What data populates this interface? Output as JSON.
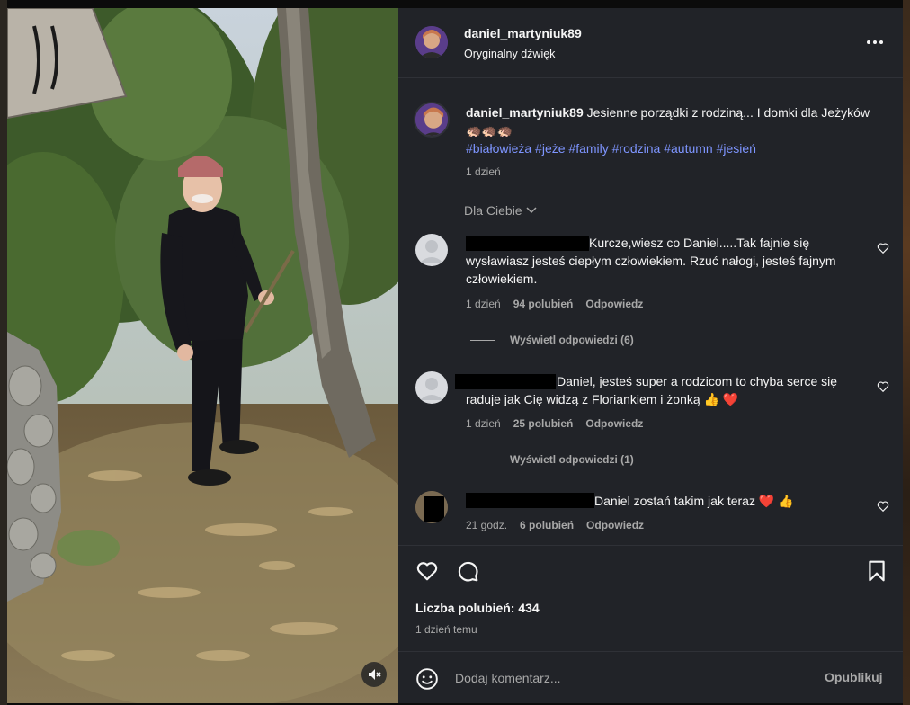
{
  "post": {
    "username": "daniel_martyniuk89",
    "audio_label": "Oryginalny dźwięk",
    "more_icon": "more-horizontal-icon"
  },
  "caption": {
    "username": "daniel_martyniuk89",
    "text": "Jesienne porządki z rodziną... I domki dla Jeżyków",
    "emoji": "🦔🦔🦔",
    "hashtags": "#białowieża #jeże #family #rodzina #autumn #jesień",
    "time": "1 dzień"
  },
  "sort_label": "Dla Ciebie",
  "comments": [
    {
      "text": "Kurcze,wiesz co Daniel.....Tak fajnie się wysławiasz jesteś ciepłym człowiekiem. Rzuć nałogi, jesteś fajnym człowiekiem.",
      "time": "1 dzień",
      "likes": "94 polubień",
      "reply": "Odpowiedz",
      "view_replies": "Wyświetl odpowiedzi (6)"
    },
    {
      "text": "Daniel, jesteś super a rodzicom to chyba serce się raduje jak Cię widzą z Floriankiem i żonką 👍 ❤️",
      "time": "1 dzień",
      "likes": "25 polubień",
      "reply": "Odpowiedz",
      "view_replies": "Wyświetl odpowiedzi (1)"
    },
    {
      "text": "Daniel zostań takim jak teraz ❤️ 👍",
      "time": "21 godz.",
      "likes": "6 polubień",
      "reply": "Odpowiedz"
    }
  ],
  "stats": {
    "likes": "Liczba polubień: 434",
    "posted": "1 dzień temu"
  },
  "composer": {
    "placeholder": "Dodaj komentarz...",
    "publish": "Opublikuj"
  },
  "colors": {
    "panel_bg": "#212328",
    "link_blue": "#7e95ff",
    "muted": "#a8a8a8"
  }
}
